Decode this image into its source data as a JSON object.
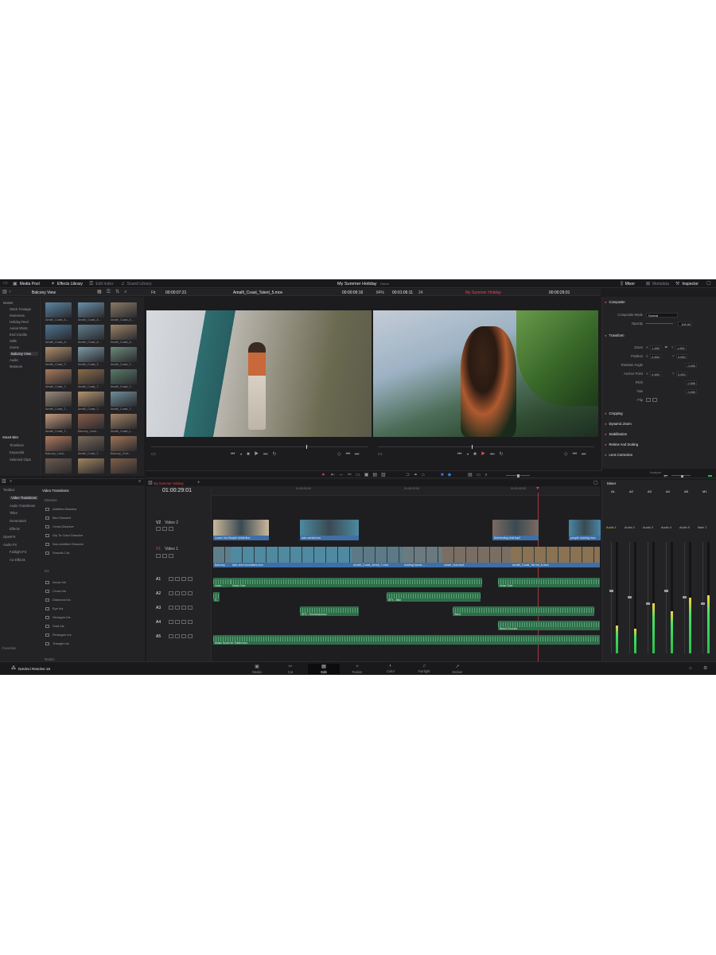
{
  "topbar": {
    "media_pool": "Media Pool",
    "effects_library": "Effects Library",
    "edit_index": "Edit Index",
    "sound_library": "Sound Library",
    "project_title": "My Summer Holiday",
    "project_state": "Edited",
    "mixer": "Mixer",
    "metadata": "Metadata",
    "inspector": "Inspector"
  },
  "source_bar": {
    "bin_name": "Balcony View",
    "zoom": "Fit",
    "source_tc": "00:00:07:21",
    "clip_name": "Amalfi_Coast_Talent_5.mov",
    "duration": "00:00:05:16",
    "zoom2": "84%",
    "program_tc_in": "00:01:06:11",
    "fps": "24",
    "timeline_name": "My Summer Holiday",
    "program_tc": "00:00:29:01"
  },
  "media_tree": {
    "items": [
      "Master",
      "Stock Footage",
      "Interviews",
      "Holiday Reel",
      "Aerial Shots",
      "End Credits",
      "Stills",
      "Scene",
      "Balcony View",
      "Audio",
      "Museum"
    ],
    "selected": "Balcony View",
    "smart_bins_title": "Smart Bins",
    "smart_bins": [
      "Timelines",
      "Keywords",
      "Selected Clips"
    ],
    "favorites": "Favorites"
  },
  "media_thumbs": [
    {
      "label": "Amalfi_Coast_A...",
      "color": "#5b86a4"
    },
    {
      "label": "Amalfi_Coast_A...",
      "color": "#6a8fa8"
    },
    {
      "label": "Amalfi_Coast_A...",
      "color": "#8a7a66"
    },
    {
      "label": "Amalfi_Coast_A...",
      "color": "#4d7590"
    },
    {
      "label": "Amalfi_Coast_A...",
      "color": "#5f7f8e"
    },
    {
      "label": "Amalfi_Coast_A...",
      "color": "#9b8468"
    },
    {
      "label": "Amalfi_Coast_T...",
      "color": "#b08e6a"
    },
    {
      "label": "Amalfi_Coast_T...",
      "color": "#7e9aa6"
    },
    {
      "label": "Amalfi_Coast_T...",
      "color": "#6b8a7a"
    },
    {
      "label": "Amalfi_Coast_T...",
      "color": "#a87a5a"
    },
    {
      "label": "Amalfi_Coast_T...",
      "color": "#8a6a48"
    },
    {
      "label": "Amalfi_Coast_T...",
      "color": "#5a7a68"
    },
    {
      "label": "Amalfi_Coast_T...",
      "color": "#9a8a7a"
    },
    {
      "label": "Amalfi_Coast_T...",
      "color": "#b4946e"
    },
    {
      "label": "Amalfi_Coast_T...",
      "color": "#6e8e9a"
    },
    {
      "label": "Amalfi_Coast_T...",
      "color": "#c49a7a"
    },
    {
      "label": "Balcony_Land...",
      "color": "#8a5e4a"
    },
    {
      "label": "Amalfi_Coast_L...",
      "color": "#a48466"
    },
    {
      "label": "Balcony_Land...",
      "color": "#b07a5e"
    },
    {
      "label": "Amalfi_Coast_T...",
      "color": "#7a6a5a"
    },
    {
      "label": "Balcony_Cont...",
      "color": "#9e7458"
    },
    {
      "label": "",
      "color": "#6a5a4e"
    },
    {
      "label": "",
      "color": "#a0845e"
    },
    {
      "label": "",
      "color": "#7e5e48"
    }
  ],
  "effects": {
    "tree": [
      "Toolbox",
      "Video Transitions",
      "Audio Transitions",
      "Titles",
      "Generators",
      "Effects",
      "OpenFX",
      "Audio FX",
      "Fairlight FX",
      "AU Effects"
    ],
    "selected": "Video Transitions",
    "header": "Video Transitions",
    "group1": "Dissolve",
    "dissolves": [
      "Additive Dissolve",
      "Blur Dissolve",
      "Cross Dissolve",
      "Dip To Color Dissolve",
      "Non-Additive Dissolve",
      "Smooth Cut"
    ],
    "group2": "Iris",
    "iris": [
      "Arrow Iris",
      "Cross Iris",
      "Diamond Iris",
      "Eye Iris",
      "Hexagon Iris",
      "Oval Iris",
      "Pentagon Iris",
      "Triangle Iris"
    ],
    "group3": "Motion"
  },
  "timeline": {
    "tab": "My Summer Holiday",
    "timecode": "01:00:29:01",
    "ruler": [
      "01:00:00:00",
      "01:00:20:00",
      "01:00:40:00"
    ],
    "v2_name": "Video 2",
    "v1_name": "Video 1",
    "v2_clips": [
      {
        "label": "Lower 3rd Simple Underline",
        "color": "#cbb89a"
      },
      {
        "label": "lake aerial.mov",
        "color": "#4c8aa0"
      },
      {
        "label": "Befriending leaf.mp4",
        "color": "#7a6a62"
      },
      {
        "label": "people running.mov",
        "color": "#4a86a6"
      }
    ],
    "v1_clips": [
      {
        "label": "Balcony ...",
        "color": "#5e7e8a"
      },
      {
        "label": "lake and mountains.mov",
        "color": "#4f8aa0"
      },
      {
        "label": "Amalfi_Coast_Aerial_7.mov",
        "color": "#5c7a86"
      },
      {
        "label": "holding hands ...",
        "color": "#6a7a7e"
      },
      {
        "label": "closer_hus.mp4",
        "color": "#7a6e62"
      },
      {
        "label": "Amalfi_Coast_Tal ent_8.mov",
        "color": "#8a7252"
      }
    ],
    "audio_tracks": [
      "A1",
      "A2",
      "A3",
      "A4",
      "A5"
    ],
    "a1_clips": [
      "Voice ...",
      "Voice Over",
      "Voice Over"
    ],
    "a2_clips": [
      "S...",
      "SFX - Bike"
    ],
    "a3_clips": [
      "SFX - Overhead.mov",
      "Wind"
    ],
    "a4_clips": [
      "Beach Sounds"
    ],
    "a5_clips": [
      "Music Score for Trailer.mov"
    ]
  },
  "inspector": {
    "composite": "Composite",
    "composite_mode_label": "Composite Mode",
    "composite_mode": "Normal",
    "opacity_label": "Opacity",
    "opacity": "100.00",
    "transform": "Transform",
    "zoom_label": "Zoom",
    "zoom_x": "1.000",
    "zoom_y": "1.000",
    "position_label": "Position",
    "pos_x": "0.000",
    "pos_y": "0.000",
    "rotation_label": "Rotation Angle",
    "rotation": "0.000",
    "anchor_label": "Anchor Point",
    "anchor_x": "0.000",
    "anchor_y": "0.000",
    "pitch_label": "Pitch",
    "pitch": "0.000",
    "yaw_label": "Yaw",
    "yaw": "0.000",
    "flip_label": "Flip",
    "sections": [
      "Cropping",
      "Dynamic Zoom",
      "Stabilization",
      "Retime And Scaling",
      "Lens Correction"
    ],
    "footer": "Analyze"
  },
  "mixer": {
    "title": "Mixer",
    "channels": [
      "A1",
      "A2",
      "A3",
      "A4",
      "A5",
      "M1"
    ],
    "names": [
      "Audio 1",
      "Audio 2",
      "Audio 3",
      "Audio 4",
      "Audio 5",
      "Main 1"
    ],
    "levels": [
      0.25,
      0.22,
      0.45,
      0.38,
      0.5,
      0.52
    ]
  },
  "pages": [
    "Media",
    "Cut",
    "Edit",
    "Fusion",
    "Color",
    "Fairlight",
    "Deliver"
  ],
  "active_page": "Edit",
  "app_name": "DaVinci Resolve 16"
}
